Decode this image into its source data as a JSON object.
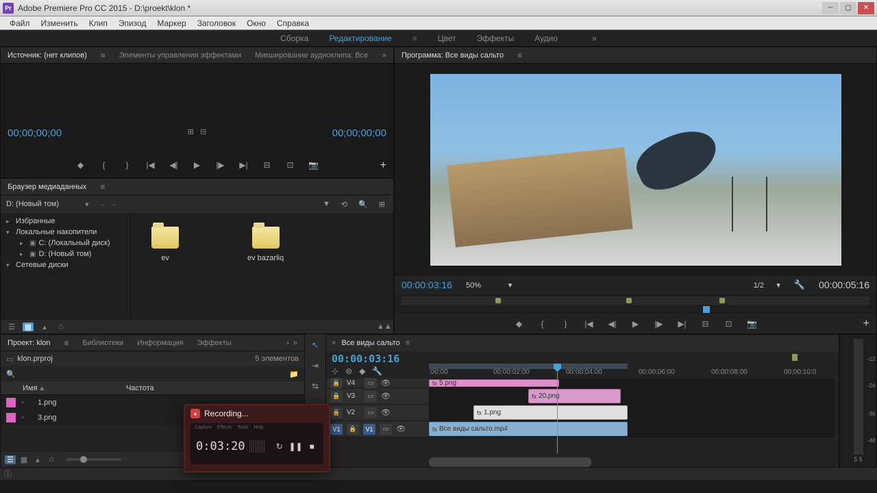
{
  "titlebar": {
    "app_icon_text": "Pr",
    "title": "Adobe Premiere Pro CC 2015 - D:\\proekt\\klon *"
  },
  "menu": [
    "Файл",
    "Изменить",
    "Клип",
    "Эпизод",
    "Маркер",
    "Заголовок",
    "Окно",
    "Справка"
  ],
  "workspace": {
    "tabs": [
      "Сборка",
      "Редактирование",
      "Цвет",
      "Эффекты",
      "Аудио"
    ],
    "active_index": 1
  },
  "source": {
    "tabs": [
      "Источник: (нет клипов)",
      "Элементы управления эффектами",
      "Микширование аудиоклипа: Все"
    ],
    "tc_left": "00;00;00;00",
    "tc_right": "00;00;00;00"
  },
  "program": {
    "title": "Программа: Все виды сальто",
    "tc_current": "00:00:03:16",
    "zoom": "50%",
    "resolution": "1/2",
    "duration": "00:00:05:16"
  },
  "media_browser": {
    "tab": "Браузер медиаданных",
    "drive": "D: (Новый том)",
    "tree": {
      "fav": "Избранные",
      "local": "Локальные накопители",
      "drive_c": "C: (Локальный диск)",
      "drive_d": "D: (Новый том)",
      "network": "Сетевые диски"
    },
    "folders": [
      "ev",
      "ev bazarliq"
    ]
  },
  "project": {
    "tabs": [
      "Проект: klon",
      "Библиотеки",
      "Информация",
      "Эффекты"
    ],
    "file": "klon.prproj",
    "count": "5 элементов",
    "col_name": "Имя",
    "col_freq": "Частота",
    "items": [
      "1.png",
      "3.png"
    ]
  },
  "timeline": {
    "sequence": "Все виды сальто",
    "timecode": "00:00:03:16",
    "ticks": [
      {
        "label": ":00:00",
        "pos": 0
      },
      {
        "label": "00:00:02:00",
        "pos": 94
      },
      {
        "label": "00:00:04:00",
        "pos": 200
      },
      {
        "label": "00:00:06:00",
        "pos": 306
      },
      {
        "label": "00:00:08:00",
        "pos": 412
      },
      {
        "label": "00:00:10:0",
        "pos": 518
      }
    ],
    "tracks": {
      "v4": "V4",
      "v3": "V3",
      "v2": "V2",
      "v1": "V1",
      "v1src": "V1"
    },
    "clips": {
      "v4": "5.png",
      "v3": "20.png",
      "v2": "1.png",
      "v1": "Все виды сальто.mp4"
    }
  },
  "audio_meters": {
    "ticks": [
      "-12",
      "-24",
      "-36",
      "-48"
    ],
    "label": "5  5"
  },
  "recording": {
    "title": "Recording...",
    "menu": [
      "Capture",
      "Effects",
      "Tools",
      "Help"
    ],
    "time": "0:03:20"
  }
}
